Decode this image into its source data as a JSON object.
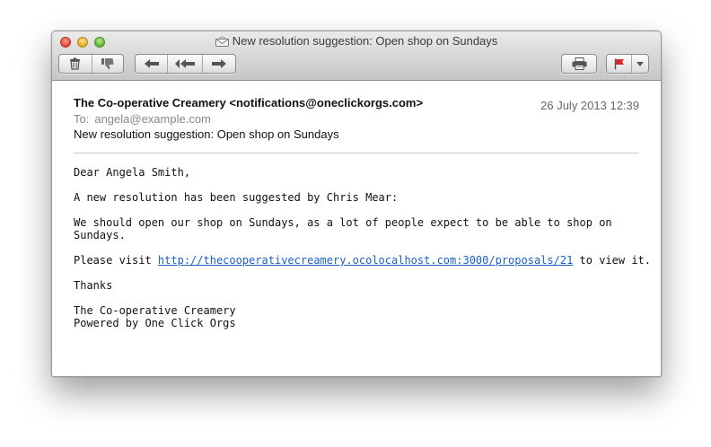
{
  "window": {
    "title": "New resolution suggestion: Open shop on Sundays"
  },
  "toolbar": {
    "buttons": [
      "delete-icon",
      "junk-icon",
      "reply-icon",
      "reply-all-icon",
      "forward-icon",
      "print-icon",
      "flag-icon",
      "flag-menu-icon"
    ],
    "flag_color": "#d9262b"
  },
  "message": {
    "from": "The Co-operative Creamery <notifications@oneclickorgs.com>",
    "date": "26 July 2013 12:39",
    "to_label": "To:",
    "to": "angela@example.com",
    "subject": "New resolution suggestion: Open shop on Sundays",
    "body": {
      "greeting": "Dear Angela Smith,",
      "intro": "A new resolution has been suggested by Chris Mear:",
      "proposal_line1": "We should open our shop on Sundays, as a lot of people expect to be able to shop on",
      "proposal_line2": "Sundays.",
      "visit_prefix": "Please visit ",
      "link": "http://thecooperativecreamery.ocolocalhost.com:3000/proposals/21",
      "visit_suffix": " to view it.",
      "thanks": "Thanks",
      "signature_line1": "The Co-operative Creamery",
      "signature_line2": "Powered by One Click Orgs"
    }
  },
  "colors": {
    "link": "#1b5fc7",
    "toolbar_top": "#ebebeb",
    "toolbar_bottom": "#c6c6c6"
  }
}
